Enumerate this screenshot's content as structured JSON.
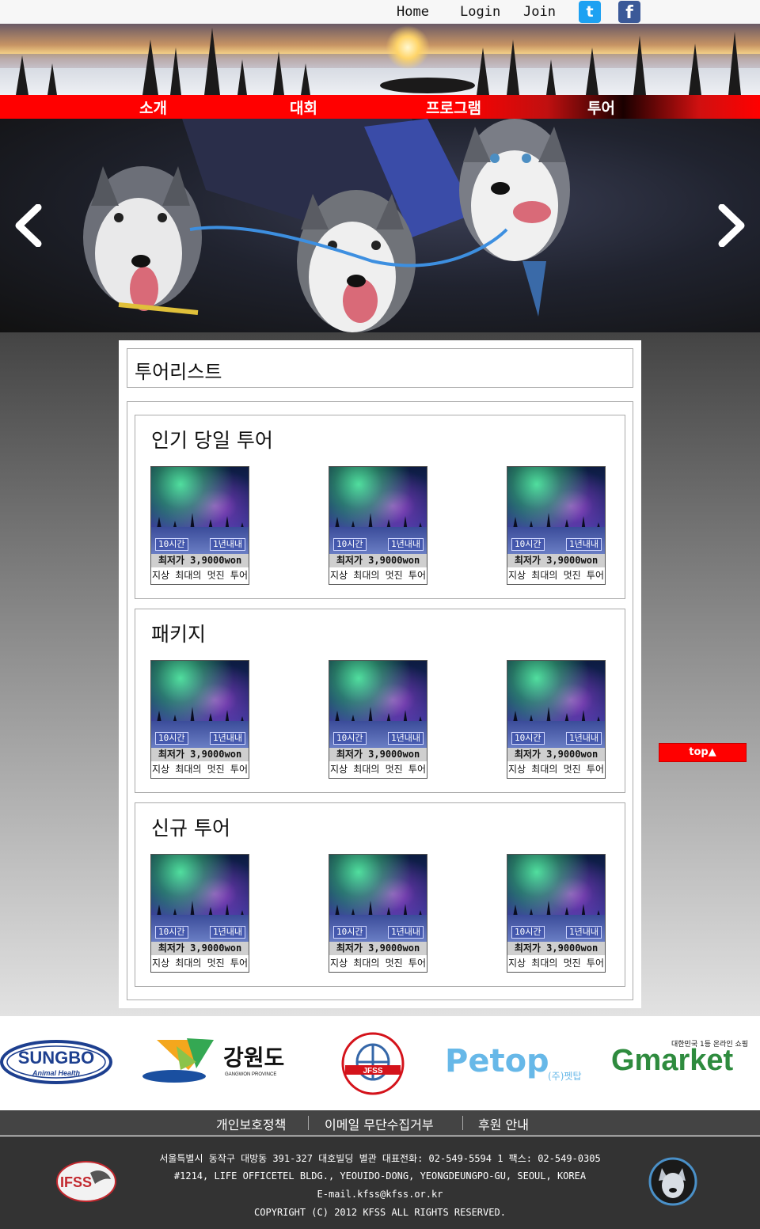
{
  "topbar": {
    "home": "Home",
    "login": "Login",
    "join": "Join",
    "twitter_glyph": "t",
    "facebook_glyph": "f",
    "twitter_color": "#1da1f2",
    "facebook_color": "#3b5998"
  },
  "nav": {
    "items": [
      "소개",
      "대회",
      "프로그램",
      "투어"
    ],
    "color": "#ff0000"
  },
  "hero": {
    "prev_icon": "chevron-left-icon",
    "next_icon": "chevron-right-icon"
  },
  "page": {
    "title": "투어리스트",
    "top_button": "top▲"
  },
  "sections": [
    {
      "title": "인기 당일 투어",
      "cards": [
        {
          "duration": "10시간",
          "validity": "1년내내",
          "price": "최저가 3,9000won",
          "desc": "지상 최대의 멋진 투어"
        },
        {
          "duration": "10시간",
          "validity": "1년내내",
          "price": "최저가 3,9000won",
          "desc": "지상 최대의 멋진 투어"
        },
        {
          "duration": "10시간",
          "validity": "1년내내",
          "price": "최저가 3,9000won",
          "desc": "지상 최대의 멋진 투어"
        }
      ]
    },
    {
      "title": "패키지",
      "cards": [
        {
          "duration": "10시간",
          "validity": "1년내내",
          "price": "최저가 3,9000won",
          "desc": "지상 최대의 멋진 투어"
        },
        {
          "duration": "10시간",
          "validity": "1년내내",
          "price": "최저가 3,9000won",
          "desc": "지상 최대의 멋진 투어"
        },
        {
          "duration": "10시간",
          "validity": "1년내내",
          "price": "최저가 3,9000won",
          "desc": "지상 최대의 멋진 투어"
        }
      ]
    },
    {
      "title": "신규 투어",
      "cards": [
        {
          "duration": "10시간",
          "validity": "1년내내",
          "price": "최저가 3,9000won",
          "desc": "지상 최대의 멋진 투어"
        },
        {
          "duration": "10시간",
          "validity": "1년내내",
          "price": "최저가 3,9000won",
          "desc": "지상 최대의 멋진 투어"
        },
        {
          "duration": "10시간",
          "validity": "1년내내",
          "price": "최저가 3,9000won",
          "desc": "지상 최대의 멋진 투어"
        }
      ]
    }
  ],
  "partners": {
    "sungbo": "SUNGBO",
    "sungbo_sub": "Animal Health",
    "gangwon": "강원도",
    "gangwon_sub": "GANGWON PROVINCE",
    "jfss": "JFSS",
    "petop": "Petop",
    "petop_sub": "(주)펫탑",
    "gmarket": "Gmarket",
    "gmarket_sub": "대한민국 1등 온라인 쇼핑"
  },
  "footer": {
    "links": [
      "개인보호정책",
      "이메일 무단수집거부",
      "후원 안내"
    ],
    "address_kr": "서울특별시 동작구 대방동 391-327 대호빌딩 별관 대표전화: 02-549-5594 1 팩스: 02-549-0305",
    "address_en": "#1214, LIFE OFFICETEL BLDG., YEOUIDO-DONG, YEONGDEUNGPO-GU, SEOUL, KOREA",
    "email": "E-mail.kfss@kfss.or.kr",
    "copyright": "COPYRIGHT (C) 2012 KFSS ALL RIGHTS RESERVED.",
    "left_logo": "IFSS"
  }
}
